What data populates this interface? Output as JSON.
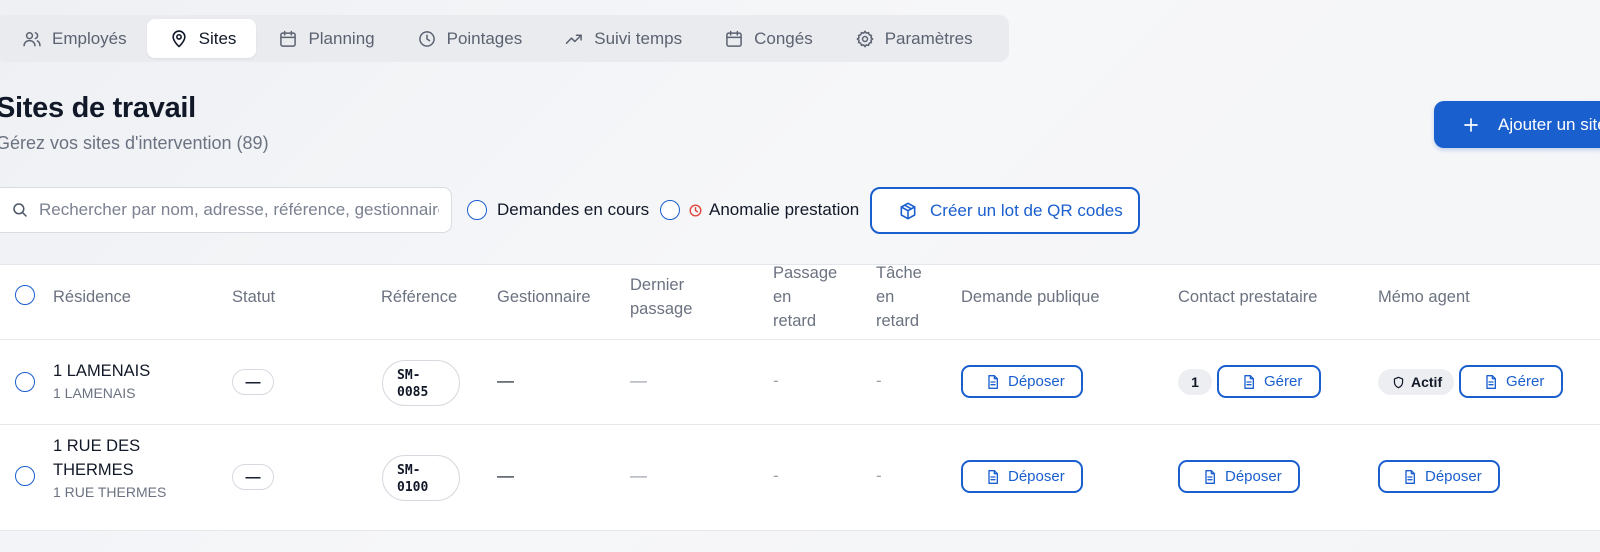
{
  "tabs": [
    {
      "label": "Employés",
      "icon": "users-icon"
    },
    {
      "label": "Sites",
      "icon": "map-pin-icon",
      "active": true
    },
    {
      "label": "Planning",
      "icon": "calendar-icon"
    },
    {
      "label": "Pointages",
      "icon": "clock-icon"
    },
    {
      "label": "Suivi temps",
      "icon": "trending-up-icon"
    },
    {
      "label": "Congés",
      "icon": "calendar-icon"
    },
    {
      "label": "Paramètres",
      "icon": "gear-icon"
    }
  ],
  "header": {
    "title": "Sites de travail",
    "subtitle": "Gérez vos sites d'intervention (89)",
    "add_button": "Ajouter un site"
  },
  "filters": {
    "search_placeholder": "Rechercher par nom, adresse, référence, gestionnaire...",
    "pending_requests": "Demandes en cours",
    "anomaly": "Anomalie prestation",
    "qr_button": "Créer un lot de QR codes"
  },
  "table": {
    "columns": {
      "residence": "Résidence",
      "status": "Statut",
      "reference": "Référence",
      "manager": "Gestionnaire",
      "last_pass_1": "Dernier",
      "last_pass_2": "passage",
      "late_pass_1": "Passage",
      "late_pass_2": "en",
      "late_pass_3": "retard",
      "late_task_1": "Tâche",
      "late_task_2": "en",
      "late_task_3": "retard",
      "public_request": "Demande publique",
      "provider_contact": "Contact prestataire",
      "agent_memo": "Mémo agent"
    },
    "rows": [
      {
        "name_1": "1 LAMENAIS",
        "name_2": "",
        "subtitle": "1 LAMENAIS",
        "status": "—",
        "reference": "SM-\n0085",
        "manager": "—",
        "last_pass": "—",
        "late_pass": "-",
        "late_task": "-",
        "public_request_btn": "Déposer",
        "provider_count": "1",
        "provider_btn": "Gérer",
        "memo_badge": "Actif",
        "memo_btn": "Gérer"
      },
      {
        "name_1": "1 RUE DES",
        "name_2": "THERMES",
        "subtitle": "1 RUE THERMES",
        "status": "—",
        "reference": "SM-\n0100",
        "manager": "—",
        "last_pass": "—",
        "late_pass": "-",
        "late_task": "-",
        "public_request_btn": "Déposer",
        "provider_btn": "Déposer",
        "memo_btn": "Déposer"
      }
    ]
  },
  "colors": {
    "accent": "#1a5fce",
    "anomaly_icon": "#e0453a"
  }
}
